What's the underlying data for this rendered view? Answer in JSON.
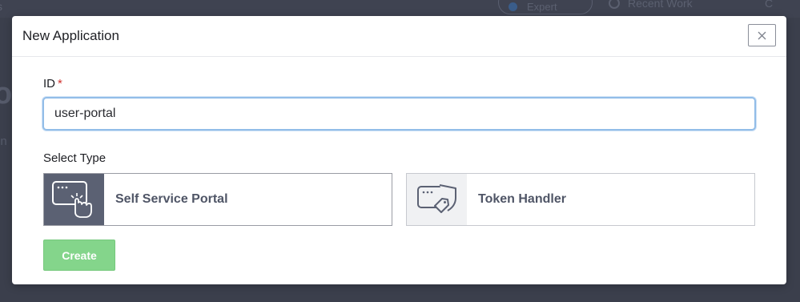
{
  "background": {
    "left_text": "s",
    "mode_pill": "Expert",
    "recent_label": "Recent Work",
    "end_label": "C",
    "side_big": "o",
    "side_small": "on"
  },
  "modal": {
    "title": "New Application",
    "close_icon": "close-icon",
    "id_field": {
      "label": "ID",
      "required_mark": "*",
      "value": "user-portal"
    },
    "type_label": "Select Type",
    "types": [
      {
        "name": "Self Service Portal",
        "icon": "portal-pointer-icon",
        "selected": true
      },
      {
        "name": "Token Handler",
        "icon": "token-handler-icon",
        "selected": false
      }
    ],
    "create_label": "Create"
  },
  "colors": {
    "accent_green": "#84d58b",
    "selected_icon_bg": "#5b6173",
    "input_focus_border": "#92bde8",
    "required": "#d0312d"
  }
}
